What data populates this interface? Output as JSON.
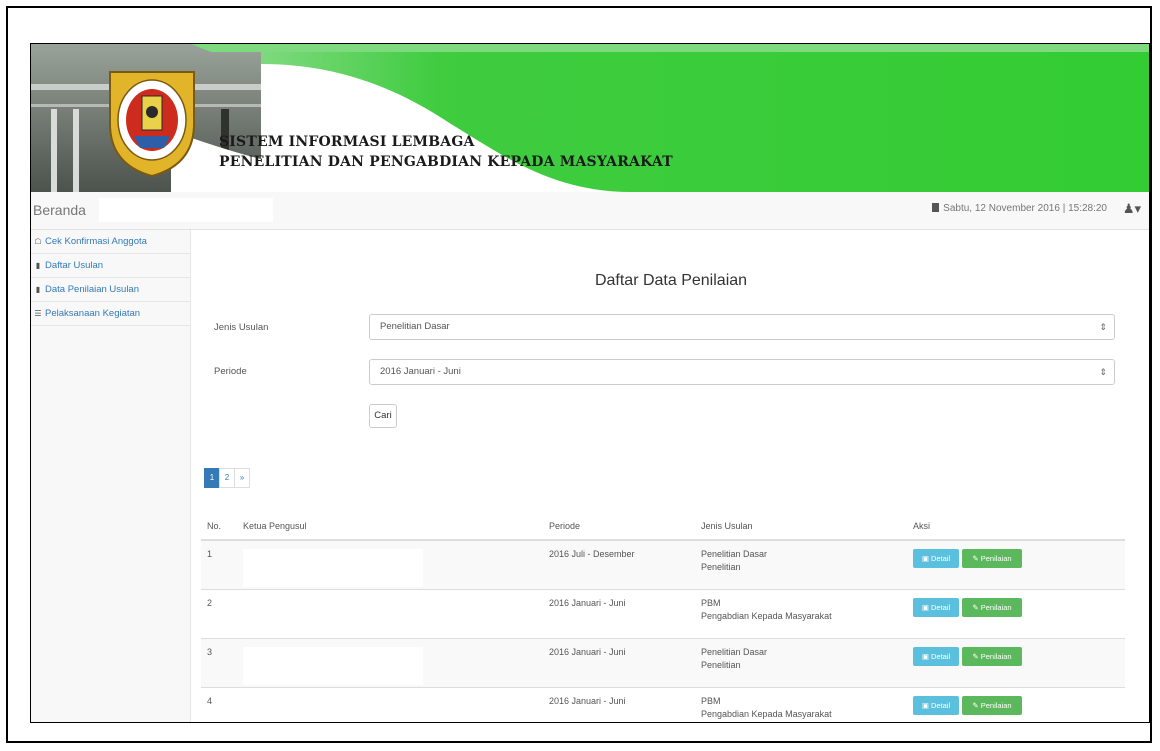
{
  "header": {
    "title_line1": "SISTEM INFORMASI LEMBAGA",
    "title_line2": "PENELITIAN DAN PENGABDIAN KEPADA MASYARAKAT",
    "accent_color": "#33cc33"
  },
  "navbar": {
    "brand": "Beranda",
    "datetime": "Sabtu, 12 November 2016 | 15:28:20",
    "user_icon": "user-icon"
  },
  "sidebar": {
    "items": [
      {
        "label": "Cek Konfirmasi Anggota",
        "icon": "home-icon"
      },
      {
        "label": "Daftar Usulan",
        "icon": "book-icon"
      },
      {
        "label": "Data Penilaian Usulan",
        "icon": "book-icon"
      },
      {
        "label": "Pelaksanaan Kegiatan",
        "icon": "list-icon"
      }
    ]
  },
  "main": {
    "title": "Daftar Data Penilaian",
    "jenis_label": "Jenis Usulan",
    "jenis_value": "Penelitian Dasar",
    "periode_label": "Periode",
    "periode_value": "2016 Januari - Juni",
    "search_button": "Cari",
    "pagination": [
      "1",
      "2",
      "»"
    ]
  },
  "table": {
    "headers": [
      "No.",
      "Ketua Pengusul",
      "Periode",
      "Jenis Usulan",
      "Aksi"
    ],
    "rows": [
      {
        "no": "1",
        "periode": "2016 Juli - Desember",
        "jenis": "Penelitian Dasar",
        "jenis_sub": "Penelitian"
      },
      {
        "no": "2",
        "periode": "2016 Januari - Juni",
        "jenis": "PBM",
        "jenis_sub": "Pengabdian Kepada Masyarakat"
      },
      {
        "no": "3",
        "periode": "2016 Januari - Juni",
        "jenis": "Penelitian Dasar",
        "jenis_sub": "Penelitian"
      },
      {
        "no": "4",
        "periode": "2016 Januari - Juni",
        "jenis": "PBM",
        "jenis_sub": "Pengabdian Kepada Masyarakat"
      }
    ],
    "detail_label": "Detail",
    "penilaian_label": "Penilaian",
    "detail_color": "#5bc0de",
    "penilaian_color": "#5cb85c"
  }
}
